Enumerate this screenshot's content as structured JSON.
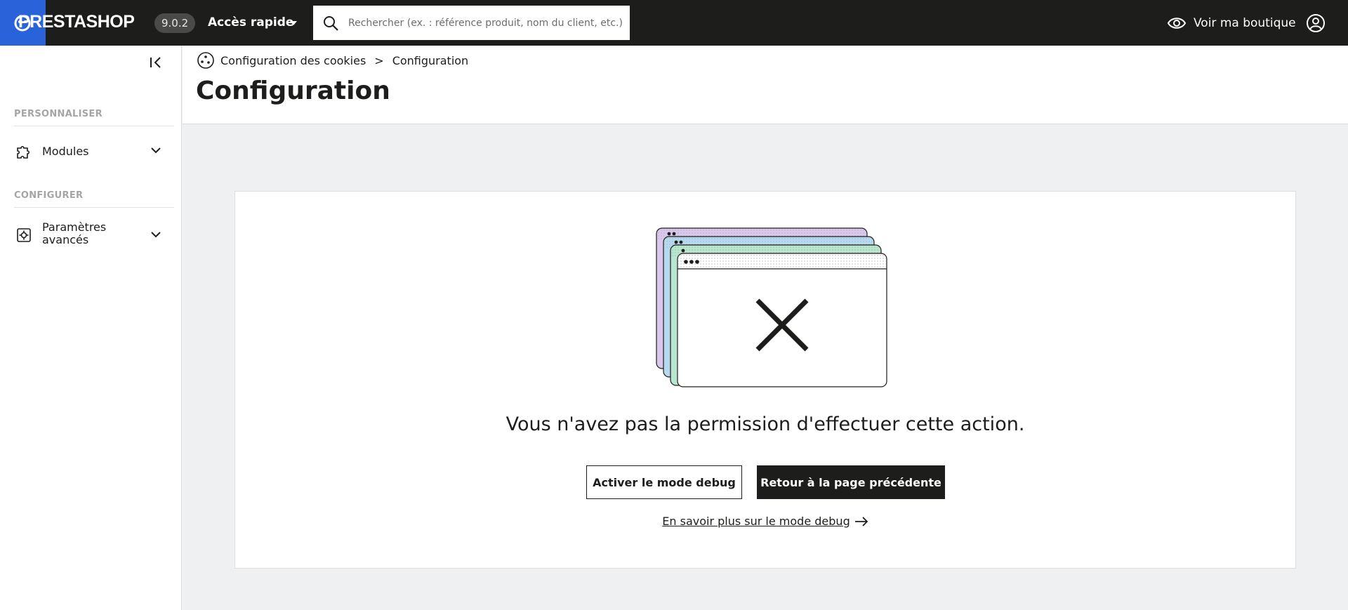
{
  "topbar": {
    "logo_text": "PRESTASHOP",
    "version": "9.0.2",
    "quick_access": "Accès rapide",
    "search_placeholder": "Rechercher (ex. : référence produit, nom du client, etc.)",
    "view_shop": "Voir ma boutique"
  },
  "sidebar": {
    "sections": [
      {
        "title": "PERSONNALISER",
        "items": [
          {
            "label": "Modules",
            "icon": "puzzle-icon"
          }
        ]
      },
      {
        "title": "CONFIGURER",
        "items": [
          {
            "label_line1": "Paramètres",
            "label_line2": "avancés",
            "icon": "settings-gear-icon"
          }
        ]
      }
    ]
  },
  "header": {
    "breadcrumb": [
      "Configuration des cookies",
      "Configuration"
    ],
    "breadcrumb_separator": ">",
    "title": "Configuration"
  },
  "main": {
    "message": "Vous n'avez pas la permission d'effectuer cette action.",
    "debug_button": "Activer le mode debug",
    "back_button": "Retour à la page précédente",
    "learn_more": "En savoir plus sur le mode debug"
  },
  "colors": {
    "topbar": "#1d1d1b",
    "logo_accent": "#2a62d9",
    "window_purple": "#d9c7ec",
    "window_blue": "#b7d9ef",
    "window_green": "#b9e6cf"
  }
}
